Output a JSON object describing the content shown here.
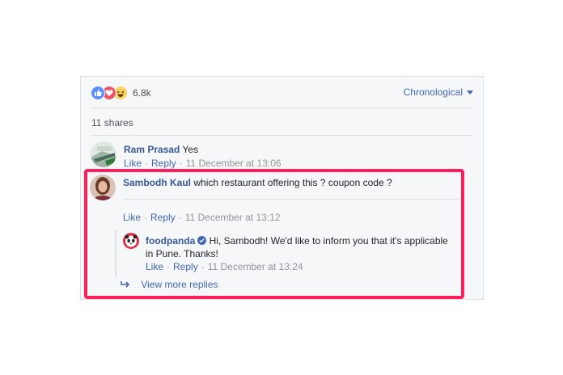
{
  "reactions": {
    "icons": [
      "like-icon",
      "love-icon",
      "haha-icon"
    ],
    "count": "6.8k"
  },
  "sort": {
    "label": "Chronological"
  },
  "shares": "11 shares",
  "comments": [
    {
      "author": "Ram Prasad",
      "text": "Yes",
      "like": "Like",
      "reply": "Reply",
      "time": "11 December at 13:06"
    },
    {
      "author": "Sambodh Kaul",
      "text": "which restaurant offering this ? coupon code ?",
      "like": "Like",
      "reply": "Reply",
      "time": "11 December at 13:12"
    }
  ],
  "reply": {
    "author": "foodpanda",
    "text_line1": "Hi, Sambodh! We'd like to inform you that it's applicable",
    "text_line2": "in Pune. Thanks!",
    "like": "Like",
    "reply": "Reply",
    "time": "11 December at 13:24"
  },
  "view_more": "View more replies",
  "colors": {
    "link": "#4267b2",
    "author": "#385898",
    "highlight": "#ff1f5a"
  }
}
